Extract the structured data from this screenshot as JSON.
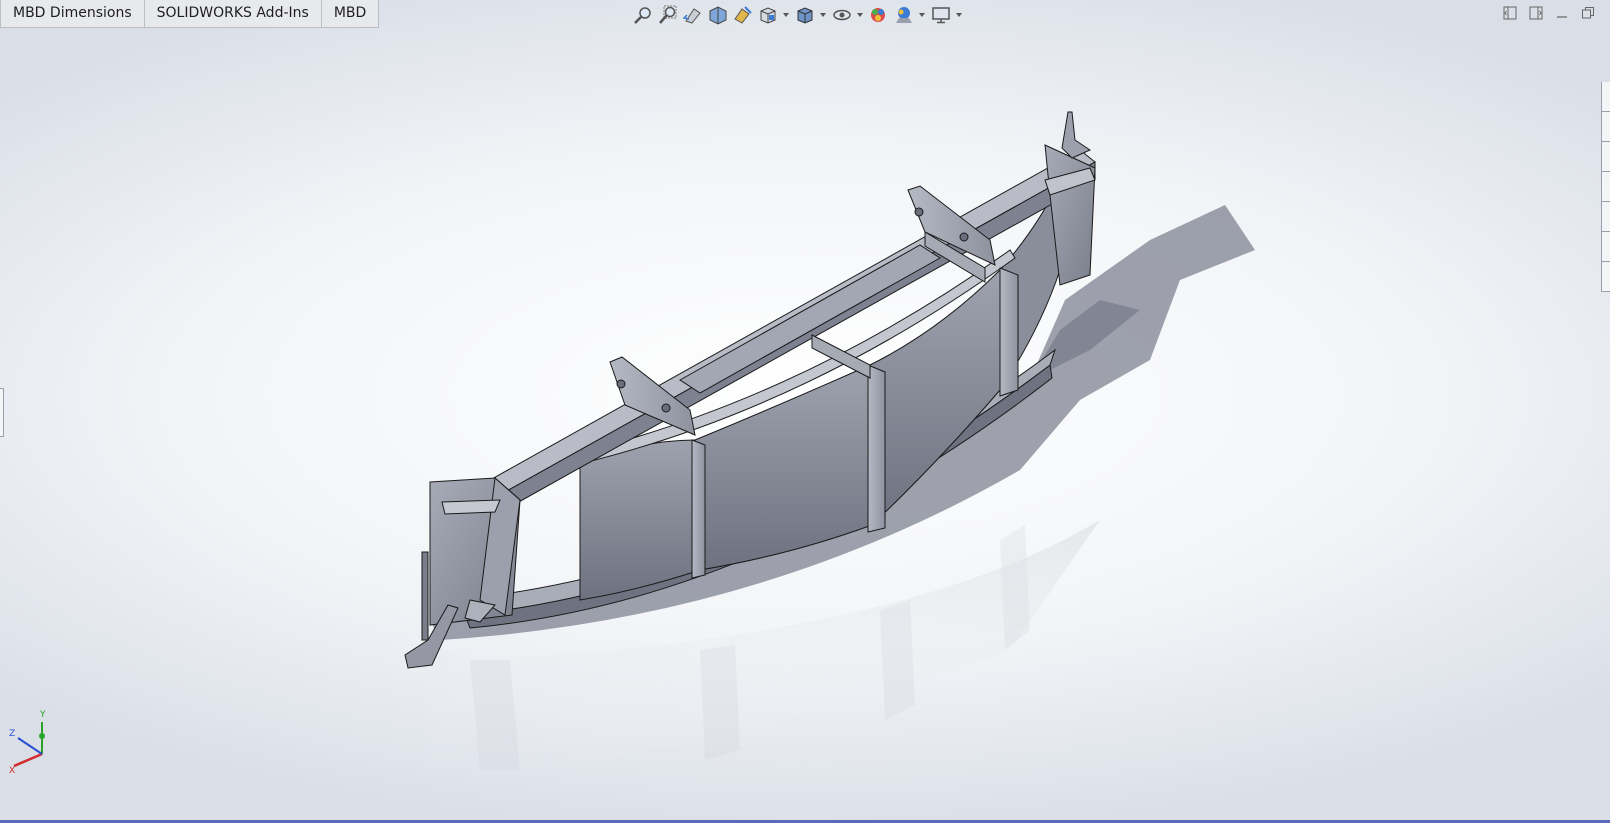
{
  "tabs": [
    {
      "label": "MBD Dimensions"
    },
    {
      "label": "SOLIDWORKS Add-Ins"
    },
    {
      "label": "MBD"
    }
  ],
  "view_toolbar": {
    "icons": [
      "zoom-to-fit-icon",
      "zoom-to-area-icon",
      "previous-view-icon",
      "section-view-icon",
      "dynamic-annotation-view-icon",
      "view-orientation-icon",
      "display-style-icon",
      "hide-show-items-icon",
      "edit-appearance-icon",
      "apply-scene-icon",
      "view-settings-icon"
    ]
  },
  "triad": {
    "x_label": "X",
    "y_label": "Y",
    "z_label": "Z",
    "x_color": "#d42a2a",
    "y_color": "#2aa32a",
    "z_color": "#2a4fd4"
  },
  "colors": {
    "model_face": "#8a8e9b",
    "model_edge": "#1a1a1a",
    "shadow": "#7e8290",
    "accent": "#5c6bb8"
  }
}
